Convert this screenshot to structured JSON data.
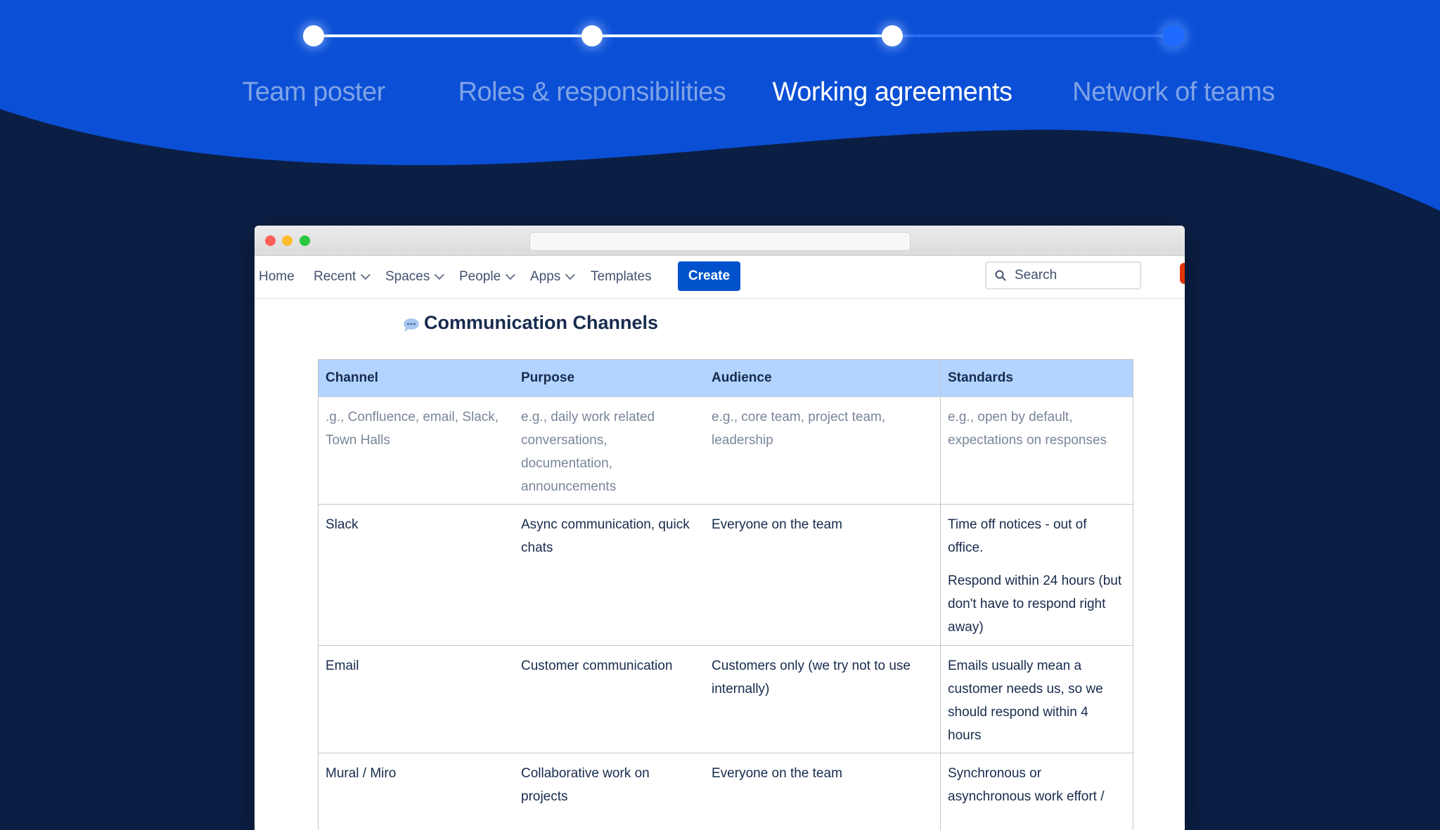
{
  "stepper": {
    "steps": [
      {
        "label": "Team poster",
        "state": "done"
      },
      {
        "label": "Roles & responsibilities",
        "state": "done"
      },
      {
        "label": "Working agreements",
        "state": "current"
      },
      {
        "label": "Network of teams",
        "state": "todo"
      }
    ]
  },
  "nav": {
    "home": "Home",
    "recent": "Recent",
    "spaces": "Spaces",
    "people": "People",
    "apps": "Apps",
    "templates": "Templates",
    "create": "Create",
    "search_placeholder": "Search"
  },
  "page": {
    "title": "Communication Channels"
  },
  "table": {
    "headers": [
      "Channel",
      "Purpose",
      "Audience",
      "Standards"
    ],
    "placeholder_row": [
      ".g., Confluence, email, Slack, Town Halls",
      "e.g., daily work related conversations, documentation, announcements",
      "e.g., core team, project team, leadership",
      "e.g., open by default, expectations on responses"
    ],
    "rows": [
      {
        "channel": "Slack",
        "purpose": "Async communication, quick chats",
        "audience": "Everyone on the team",
        "standards": [
          "Time off notices - out of office.",
          "Respond within 24 hours (but don't have to respond right away)"
        ]
      },
      {
        "channel": "Email",
        "purpose": "Customer communication",
        "audience": "Customers only (we try not to use internally)",
        "standards": [
          "Emails usually mean a customer needs us, so we should respond within 4 hours"
        ]
      },
      {
        "channel": "Mural / Miro",
        "purpose": "Collaborative work on projects",
        "audience": "Everyone on the team",
        "standards": [
          "Synchronous or asynchronous work effort /"
        ]
      }
    ]
  },
  "colors": {
    "accent": "#0052cc",
    "header_bg": "#b3d4ff",
    "banner_blue": "#0b4fd6",
    "background": "#0b1f45"
  }
}
